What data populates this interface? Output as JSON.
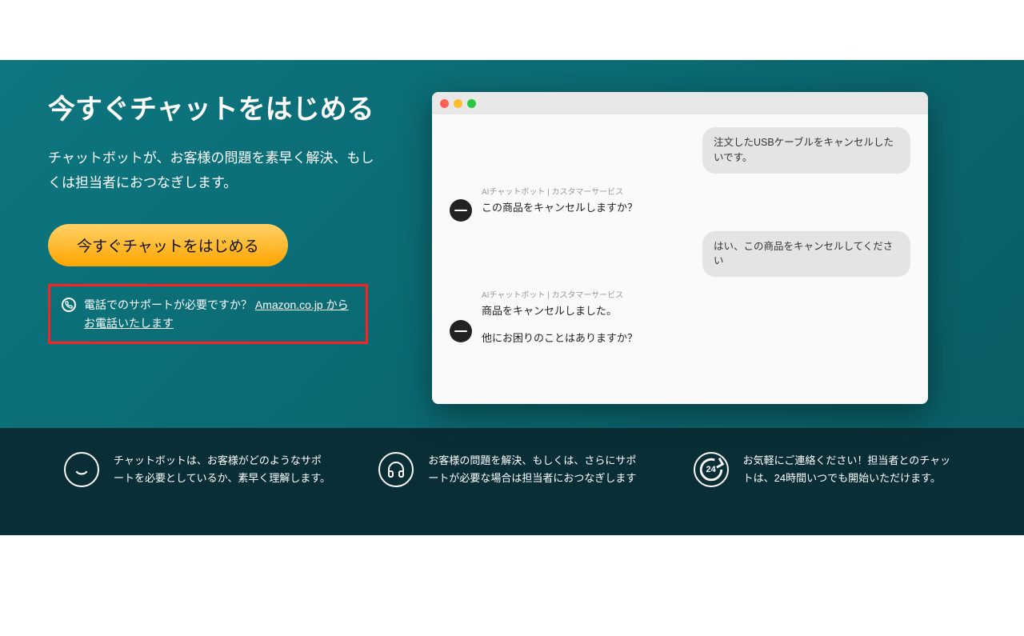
{
  "hero": {
    "title": "今すぐチャットをはじめる",
    "description": "チャットボットが、お客様の問題を素早く解決、もしくは担当者におつなぎします。",
    "cta_label": "今すぐチャットをはじめる",
    "phone_prompt": "電話でのサポートが必要ですか？ ",
    "phone_link": "Amazon.co.jp からお電話いたします"
  },
  "chat": {
    "bot_label": "AIチャットボット | カスタマーサービス",
    "messages": {
      "user1": "注文したUSBケーブルをキャンセルしたいです。",
      "bot1": "この商品をキャンセルしますか？",
      "user2": "はい、この商品をキャンセルしてください",
      "bot2a": "商品をキャンセルしました。",
      "bot2b": "他にお困りのことはありますか？"
    }
  },
  "footer": {
    "item1": "チャットボットは、お客様がどのようなサポートを必要としているか、素早く理解します。",
    "item2": "お客様の問題を解決、もしくは、さらにサポートが必要な場合は担当者におつなぎします",
    "item3": "お気軽にご連絡ください！担当者とのチャットは、24時間いつでも開始いただけます。",
    "clock_label": "24"
  }
}
